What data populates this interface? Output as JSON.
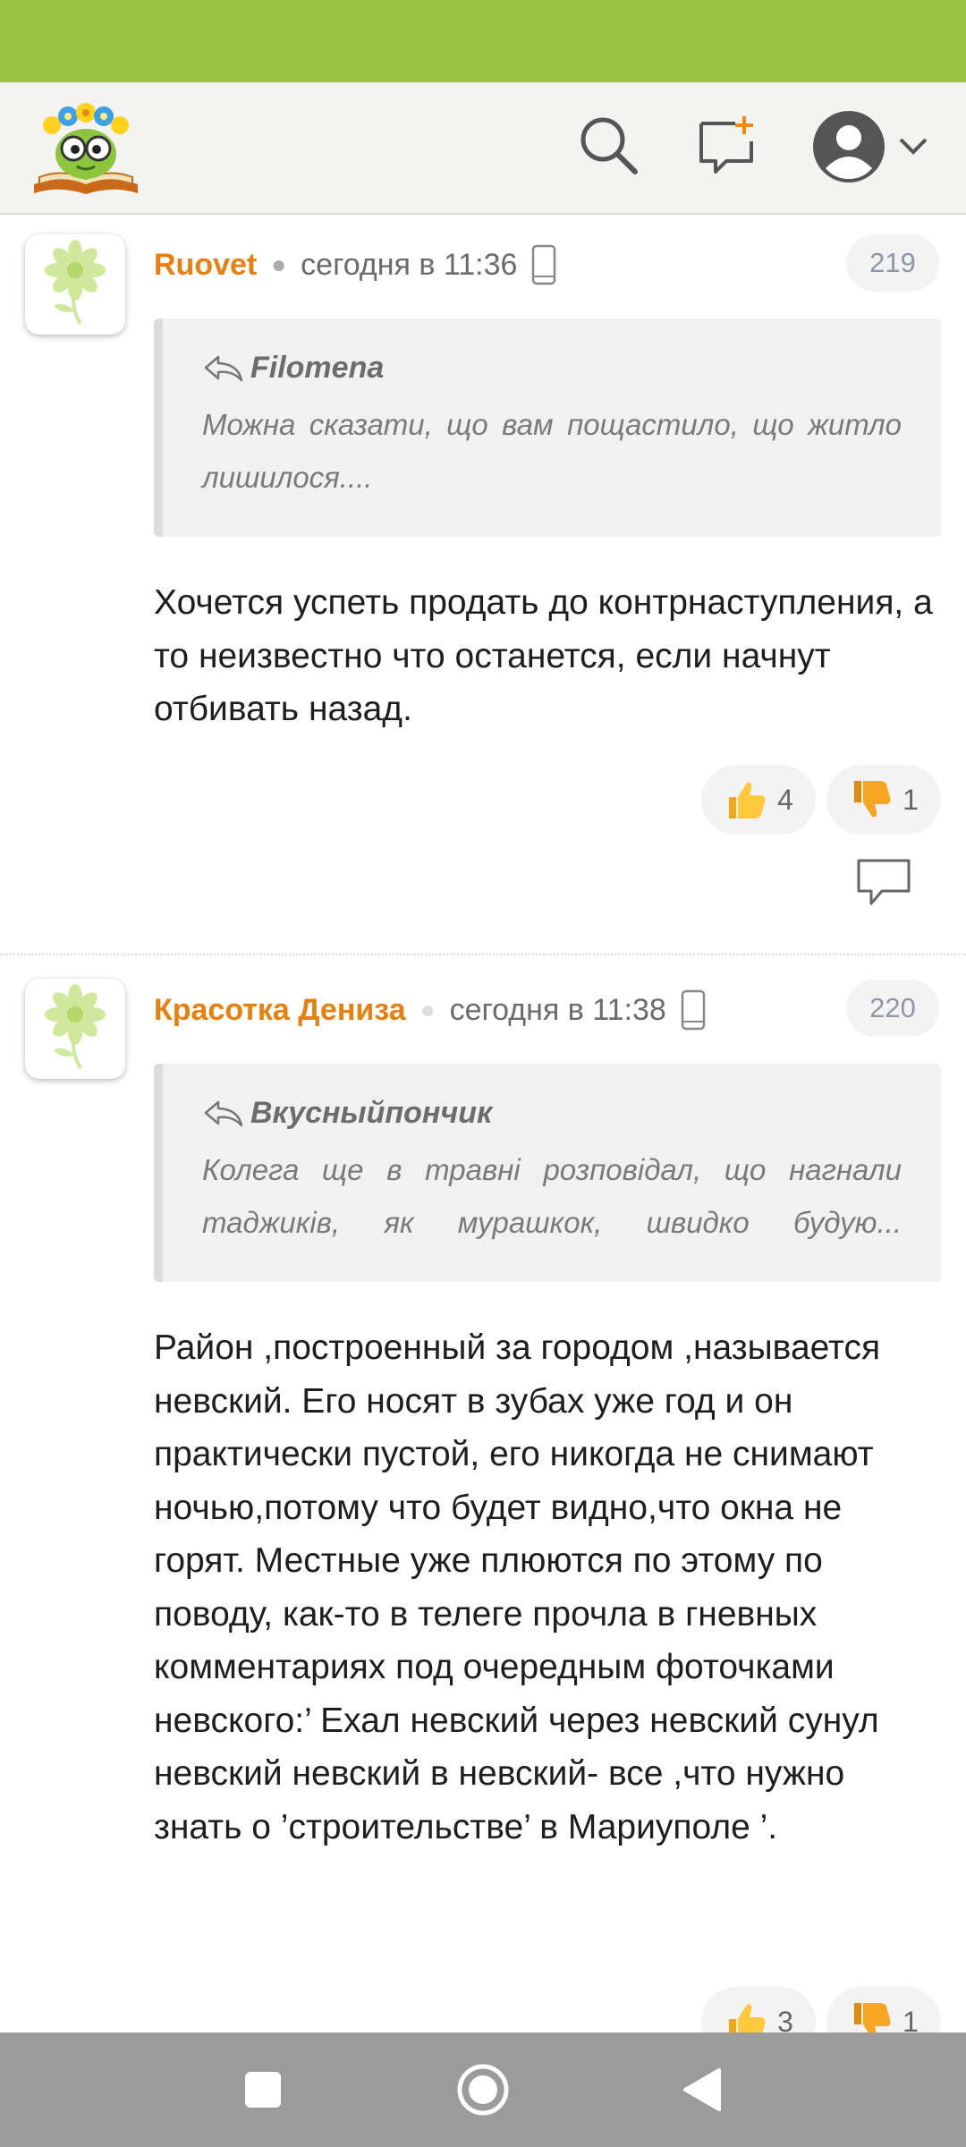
{
  "comments": [
    {
      "author": "Ruovet",
      "time": "сегодня в 11:36",
      "number": "219",
      "quote_author": "Filomena",
      "quote_text": "Можна сказати, що вам пощастило, що житло лишилося....",
      "body": "Хочется успеть продать до контрнаступления, а то неизвестно что останется, если начнут отбивать назад.",
      "likes": "4",
      "dislikes": "1"
    },
    {
      "author": "Красотка Дениза",
      "time": "сегодня в 11:38",
      "number": "220",
      "quote_author": "Вкусныйпончик",
      "quote_text": "Колега ще в травні розповідал, що нагнали таджиків, як мурашкок, швидко будую...",
      "body": "Район ,построенный за городом ,называется невский. Его носят в зубах уже год и он практически пустой, его никогда не снимают ночью,потому что будет видно,что окна не горят. Местные уже плюются по этому по поводу, как-то в телеге прочла в гневных комментариях под очередным фоточками невского:’ Ехал невский через невский сунул невский невский в невский- все ,что нужно знать о ’строительстве’ в Мариуполе ’.",
      "likes": "3",
      "dislikes": "1"
    }
  ],
  "colors": {
    "status_bar": "#9dc244",
    "author": "#e8800f",
    "badge_text": "#8d97a8",
    "nav_bar": "#9b9b9b"
  },
  "icons": [
    "logo-icon",
    "search-icon",
    "new-post-icon",
    "avatar-icon",
    "chevron-down-icon",
    "flower-icon",
    "phone-icon",
    "reply-arrow-icon",
    "thumbs-up-icon",
    "thumbs-down-icon",
    "reply-bubble-icon",
    "nav-square-icon",
    "nav-circle-icon",
    "nav-back-icon"
  ]
}
